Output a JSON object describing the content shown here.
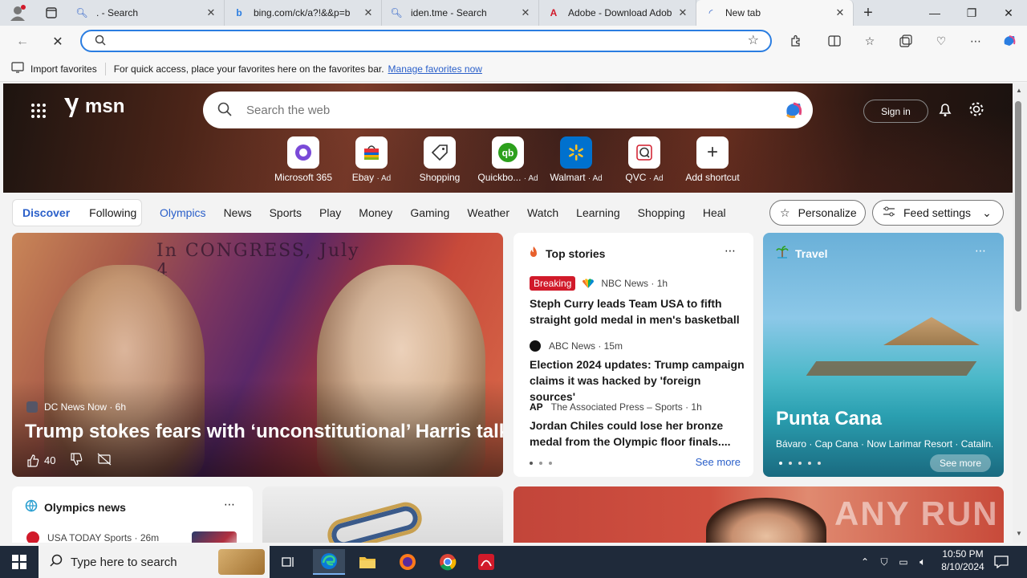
{
  "browser": {
    "tabs": [
      {
        "label": ". - Search",
        "icon": "search-icon"
      },
      {
        "label": "bing.com/ck/a?!&&p=b",
        "icon": "bing-icon"
      },
      {
        "label": "iden.tme - Search",
        "icon": "search-icon"
      },
      {
        "label": "Adobe - Download Adob",
        "icon": "adobe-icon"
      },
      {
        "label": "New tab",
        "icon": "loading-icon"
      }
    ],
    "address_value": "",
    "favbar_import": "Import favorites",
    "favbar_hint": "For quick access, place your favorites here on the favorites bar.",
    "favbar_manage": "Manage favorites now"
  },
  "msn": {
    "logo_text": "msn",
    "search_placeholder": "Search the web",
    "signin_label": "Sign in",
    "shortcuts": [
      {
        "name": "Microsoft 365",
        "ad": ""
      },
      {
        "name": "Ebay",
        "ad": "· Ad"
      },
      {
        "name": "Shopping",
        "ad": ""
      },
      {
        "name": "Quickbo...",
        "ad": "· Ad"
      },
      {
        "name": "Walmart",
        "ad": "· Ad"
      },
      {
        "name": "QVC",
        "ad": "· Ad"
      },
      {
        "name": "Add shortcut",
        "ad": ""
      }
    ],
    "pills": {
      "discover": "Discover",
      "following": "Following"
    },
    "nav_links": [
      "Olympics",
      "News",
      "Sports",
      "Play",
      "Money",
      "Gaming",
      "Weather",
      "Watch",
      "Learning",
      "Shopping",
      "Heal"
    ],
    "personalize_label": "Personalize",
    "feed_settings_label": "Feed settings"
  },
  "hero_story": {
    "source": "DC News Now · 6h",
    "headline": "Trump stokes fears with ‘unconstitutional’ Harris talk",
    "likes": "40",
    "doc_text": "In CONGRESS, July 4"
  },
  "top_stories": {
    "title": "Top stories",
    "items": [
      {
        "badge": "Breaking",
        "source": "NBC News · 1h",
        "title": "Steph Curry leads Team USA to fifth straight gold medal in men's basketball"
      },
      {
        "badge": "",
        "source": "ABC News · 15m",
        "title": "Election 2024 updates: Trump campaign claims it was hacked by 'foreign sources'"
      },
      {
        "badge": "",
        "source": "The Associated Press – Sports · 1h",
        "title": "Jordan Chiles could lose her bronze medal from the Olympic floor finals...."
      }
    ],
    "see_more": "See more"
  },
  "travel": {
    "title": "Travel",
    "place": "Punta Cana",
    "sub": "Bávaro · Cap Cana · Now Larimar Resort · Catalin...",
    "see_more": "See more"
  },
  "olympics_news": {
    "title": "Olympics news",
    "item_source": "USA TODAY Sports · 26m"
  },
  "watermark": "ANY RUN",
  "taskbar": {
    "search_placeholder": "Type here to search",
    "time": "10:50 PM",
    "date": "8/10/2024"
  }
}
